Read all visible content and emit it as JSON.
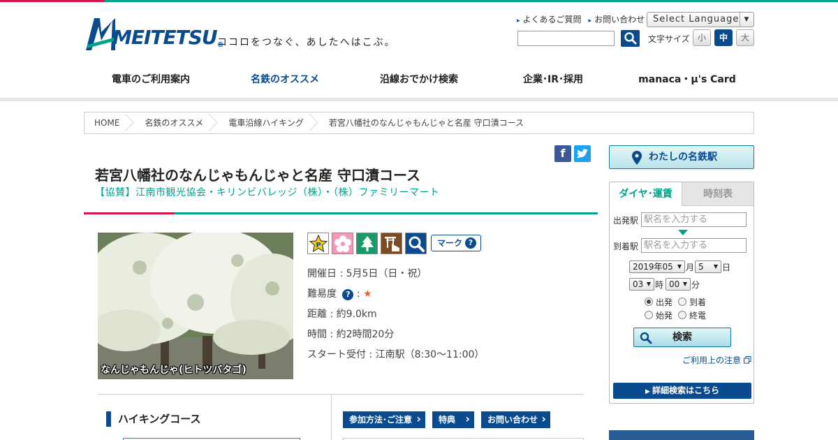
{
  "header": {
    "logo_text": "MEITETSU",
    "tagline": "ココロをつなぐ、あしたへはこぶ。",
    "util_links": [
      "よくあるご質問",
      "お問い合わせ"
    ],
    "language_select": "Select Language",
    "font_size_label": "文字サイズ",
    "font_sizes": [
      "小",
      "中",
      "大"
    ]
  },
  "gnav": [
    "電車のご利用案内",
    "名鉄のオススメ",
    "沿線おでかけ検索",
    "企業･IR･採用",
    "manaca・μ's Card"
  ],
  "breadcrumb": [
    "HOME",
    "名鉄のオススメ",
    "電車沿線ハイキング",
    "若宮八幡社のなんじゃもんじゃと名産 守口漬コース"
  ],
  "article": {
    "title": "若宮八幡社のなんじゃもんじゃと名産 守口漬コース",
    "sponsor": "【協賛】江南市観光協会・キリンビバレッジ（株）・（株）ファミリーマート",
    "photo_caption": "なんじゃもんじゃ(ヒトツバタゴ)",
    "mark_legend": "マーク",
    "date": "開催日 : 5月5日（日・祝）",
    "difficulty_label": "難易度",
    "difficulty_sep": ":",
    "difficulty_star": "★",
    "distance": "距離 : 約9.0km",
    "time": "時間 : 約2時間20分",
    "start": "スタート受付 : 江南駅（8:30～11:00）",
    "section_heading": "ハイキングコース",
    "tabs": [
      "参加方法･ご注意",
      "特典",
      "お問い合わせ"
    ]
  },
  "sidebar": {
    "my_station": "わたしの名鉄駅",
    "tabs": [
      "ダイヤ･運賃",
      "時刻表"
    ],
    "from_label": "出発駅",
    "to_label": "到着駅",
    "station_placeholder": "駅名を入力する",
    "year_month": "2019年05",
    "month_unit": "月",
    "day": "5",
    "day_unit": "日",
    "hour": "03",
    "hour_unit": "時",
    "minute": "00",
    "minute_unit": "分",
    "radios": [
      "出発",
      "到着",
      "始発",
      "終電"
    ],
    "search_button": "検索",
    "note_link": "ご利用上の注意",
    "detail_button": "詳細検索はこちら"
  },
  "colors": {
    "brand": "#0a4b8f",
    "accent": "#00a38b",
    "red": "#d7154f"
  }
}
